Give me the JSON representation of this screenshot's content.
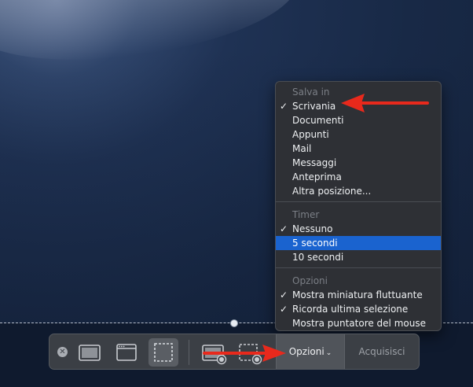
{
  "menu": {
    "save_header": "Salva in",
    "save_items": [
      {
        "label": "Scrivania",
        "checked": true
      },
      {
        "label": "Documenti",
        "checked": false
      },
      {
        "label": "Appunti",
        "checked": false
      },
      {
        "label": "Mail",
        "checked": false
      },
      {
        "label": "Messaggi",
        "checked": false
      },
      {
        "label": "Anteprima",
        "checked": false
      },
      {
        "label": "Altra posizione...",
        "checked": false
      }
    ],
    "timer_header": "Timer",
    "timer_items": [
      {
        "label": "Nessuno",
        "checked": true
      },
      {
        "label": "5 secondi",
        "checked": false,
        "highlighted": true
      },
      {
        "label": "10 secondi",
        "checked": false
      }
    ],
    "options_header": "Opzioni",
    "options_items": [
      {
        "label": "Mostra miniatura fluttuante",
        "checked": true
      },
      {
        "label": "Ricorda ultima selezione",
        "checked": true
      },
      {
        "label": "Mostra puntatore del mouse",
        "checked": false
      }
    ],
    "checkmark": "✓"
  },
  "toolbar": {
    "options_label": "Opzioni",
    "options_chevron": "⌄",
    "capture_label": "Acquisisci",
    "close_glyph": "✕",
    "tools": [
      "capture-entire-screen-icon",
      "capture-window-icon",
      "capture-selection-icon",
      "record-entire-screen-icon",
      "record-selection-icon"
    ],
    "active_tool": "capture-selection-icon"
  },
  "colors": {
    "highlight": "#1a63cf",
    "annotation_arrow": "#e8291c"
  }
}
